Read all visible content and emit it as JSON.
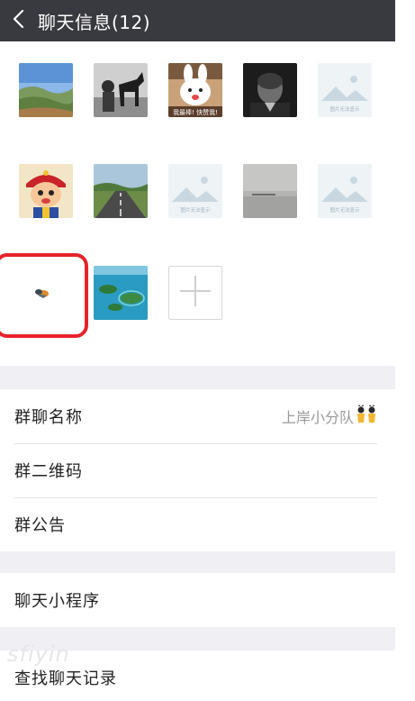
{
  "header": {
    "back_icon": "chevron-left-icon",
    "title": "聊天信息(12)"
  },
  "members": {
    "avatars": [
      {
        "name": "member-avatar-landscape",
        "desc": "landscape-photo"
      },
      {
        "name": "member-avatar-horse",
        "desc": "bw-photo-child-horse"
      },
      {
        "name": "member-avatar-rabbit",
        "desc": "rabbit-sticker",
        "caption": "我最棒! 快赞我!"
      },
      {
        "name": "member-avatar-bw-portrait",
        "desc": "bw-portrait"
      },
      {
        "name": "member-avatar-placeholder",
        "desc": "image-unavailable",
        "caption": "图片无法显示"
      },
      {
        "name": "member-avatar-cartoon",
        "desc": "cartoon-boy"
      },
      {
        "name": "member-avatar-road",
        "desc": "road-photo"
      },
      {
        "name": "member-avatar-placeholder",
        "desc": "image-unavailable",
        "caption": "图片无法显示"
      },
      {
        "name": "member-avatar-fog",
        "desc": "foggy-lake"
      },
      {
        "name": "member-avatar-placeholder",
        "desc": "image-unavailable",
        "caption": "图片无法显示"
      },
      {
        "name": "member-avatar-bird",
        "desc": "tiny-bird"
      },
      {
        "name": "member-avatar-islands",
        "desc": "sea-islands"
      }
    ],
    "add_icon": "plus-icon"
  },
  "settings": {
    "group_name_label": "群聊名称",
    "group_name_value": "上岸小分队",
    "group_name_emoji": "dancers-emoji",
    "qr_code_label": "群二维码",
    "announcement_label": "群公告",
    "mini_programs_label": "聊天小程序",
    "search_history_label": "查找聊天记录"
  },
  "watermark": "sfiyin",
  "colors": {
    "header_bg": "#393a3f",
    "highlight": "#e8222a",
    "gap_bg": "#efeff4"
  }
}
